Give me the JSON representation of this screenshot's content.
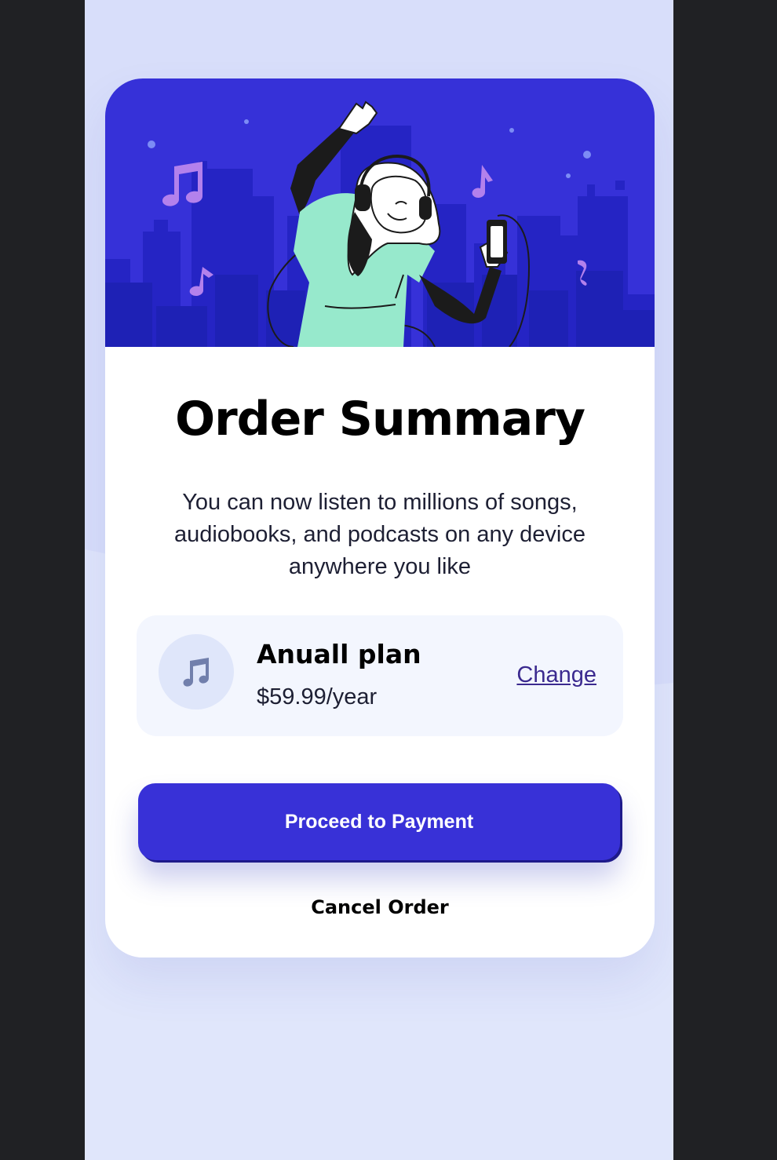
{
  "card": {
    "title": "Order Summary",
    "description": "You can now listen to millions of songs, audiobooks, and podcasts on any device anywhere you like"
  },
  "plan": {
    "icon": "music-note-icon",
    "name": "Anuall plan",
    "price": "$59.99/year",
    "change_label": "Change"
  },
  "actions": {
    "proceed_label": "Proceed to Payment",
    "cancel_label": "Cancel Order"
  },
  "colors": {
    "page_background": "#e0e6fb",
    "hero_background": "#3631d8",
    "primary_button": "#3831d7",
    "plan_box": "#f3f6fe",
    "link": "#3b2a8f"
  }
}
